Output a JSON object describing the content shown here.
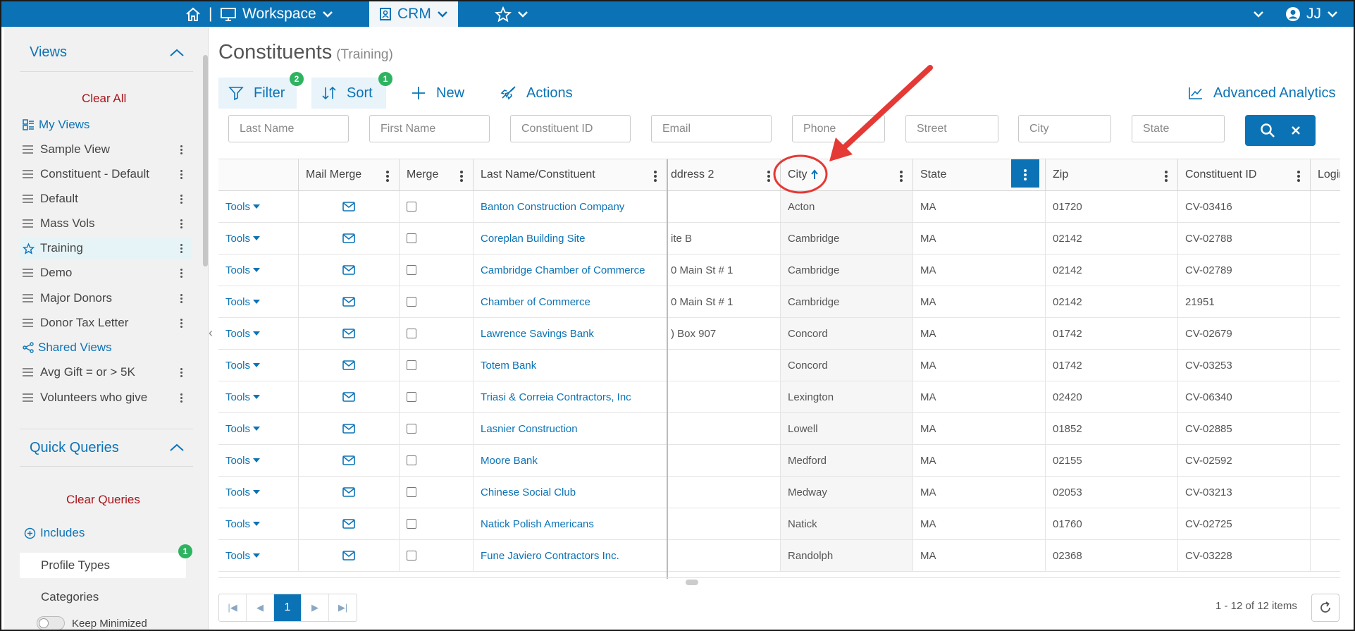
{
  "topbar": {
    "workspace_label": "Workspace",
    "crm_label": "CRM",
    "user_initials": "JJ",
    "separator": "|"
  },
  "sidebar": {
    "views_title": "Views",
    "clear_all": "Clear All",
    "my_views": "My Views",
    "my_items": [
      {
        "label": "Sample View"
      },
      {
        "label": "Constituent - Default"
      },
      {
        "label": "Default"
      },
      {
        "label": "Mass Vols"
      },
      {
        "label": "Training"
      },
      {
        "label": "Demo"
      },
      {
        "label": "Major Donors"
      },
      {
        "label": "Donor Tax Letter"
      }
    ],
    "shared_views": "Shared Views",
    "shared_items": [
      {
        "label": "Avg Gift = or > 5K"
      },
      {
        "label": "Volunteers who give"
      }
    ],
    "quick_queries_title": "Quick Queries",
    "clear_queries": "Clear Queries",
    "includes": "Includes",
    "profile_types": "Profile Types",
    "profile_types_badge": "1",
    "categories": "Categories",
    "keep_minimized": "Keep Minimized"
  },
  "page": {
    "title": "Constituents",
    "subtitle": "(Training)"
  },
  "toolbar": {
    "filter": "Filter",
    "filter_badge": "2",
    "sort": "Sort",
    "sort_badge": "1",
    "new": "New",
    "actions": "Actions",
    "advanced_analytics": "Advanced Analytics"
  },
  "search": {
    "last_name": "Last Name",
    "first_name": "First Name",
    "constituent_id": "Constituent ID",
    "email": "Email",
    "phone": "Phone",
    "street": "Street",
    "city": "City",
    "state": "State"
  },
  "grid": {
    "headers": {
      "mail_merge": "Mail Merge",
      "merge": "Merge",
      "last_name": "Last Name/Constituent",
      "address2": "ddress 2",
      "city": "City",
      "state": "State",
      "zip": "Zip",
      "constituent_id": "Constituent ID",
      "login": "Login"
    },
    "tools_label": "Tools",
    "rows": [
      {
        "name": "Banton Construction Company",
        "addr2": "",
        "city": "Acton",
        "state": "MA",
        "zip": "01720",
        "cid": "CV-03416"
      },
      {
        "name": "Coreplan Building Site",
        "addr2": "ite B",
        "city": "Cambridge",
        "state": "MA",
        "zip": "02142",
        "cid": "CV-02788"
      },
      {
        "name": "Cambridge Chamber of Commerce",
        "addr2": "0 Main St # 1",
        "city": "Cambridge",
        "state": "MA",
        "zip": "02142",
        "cid": "CV-02789"
      },
      {
        "name": "Chamber of Commerce",
        "addr2": "0 Main St # 1",
        "city": "Cambridge",
        "state": "MA",
        "zip": "02142",
        "cid": "21951"
      },
      {
        "name": "Lawrence Savings Bank",
        "addr2": ") Box 907",
        "city": "Concord",
        "state": "MA",
        "zip": "01742",
        "cid": "CV-02679"
      },
      {
        "name": "Totem Bank",
        "addr2": "",
        "city": "Concord",
        "state": "MA",
        "zip": "01742",
        "cid": "CV-03253"
      },
      {
        "name": "Triasi & Correia Contractors, Inc",
        "addr2": "",
        "city": "Lexington",
        "state": "MA",
        "zip": "02420",
        "cid": "CV-06340"
      },
      {
        "name": "Lasnier Construction",
        "addr2": "",
        "city": "Lowell",
        "state": "MA",
        "zip": "01852",
        "cid": "CV-02885"
      },
      {
        "name": "Moore Bank",
        "addr2": "",
        "city": "Medford",
        "state": "MA",
        "zip": "02155",
        "cid": "CV-02592"
      },
      {
        "name": "Chinese Social Club",
        "addr2": "",
        "city": "Medway",
        "state": "MA",
        "zip": "02053",
        "cid": "CV-03213"
      },
      {
        "name": "Natick Polish Americans",
        "addr2": "",
        "city": "Natick",
        "state": "MA",
        "zip": "01760",
        "cid": "CV-02725"
      },
      {
        "name": "Fune Javiero Contractors Inc.",
        "addr2": "",
        "city": "Randolph",
        "state": "MA",
        "zip": "02368",
        "cid": "CV-03228"
      }
    ]
  },
  "pager": {
    "current_page": "1",
    "info": "1 - 12 of 12 items"
  },
  "colors": {
    "brand": "#0b73b5",
    "badge": "#2eb360",
    "danger": "#a8141a",
    "annotation": "#e53935"
  }
}
